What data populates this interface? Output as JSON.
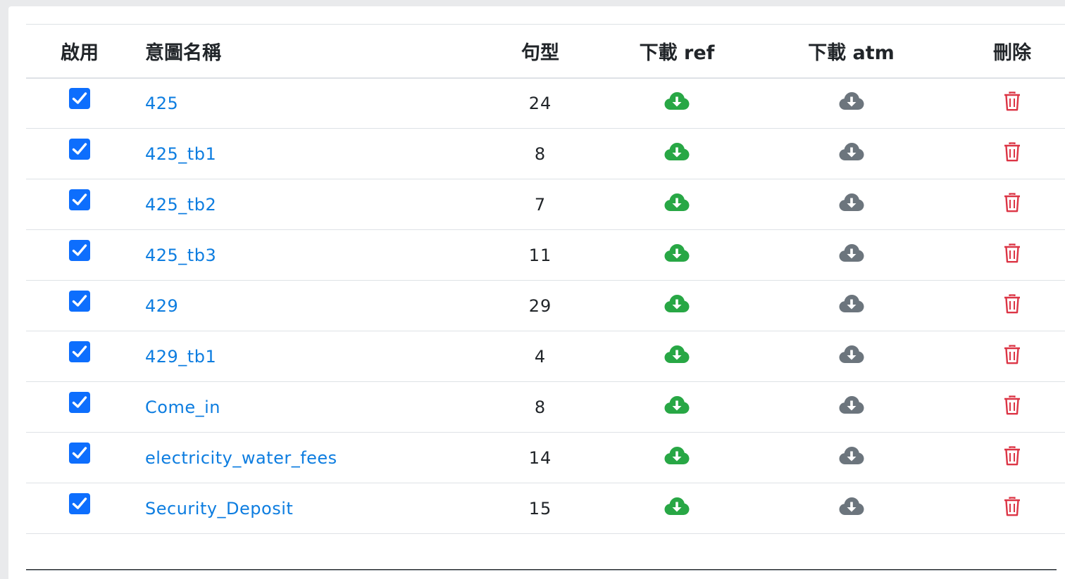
{
  "header": {
    "enabled": "啟用",
    "intent_name": "意圖名稱",
    "sentence_count": "句型",
    "download_ref": "下載 ref",
    "download_atm": "下載 atm",
    "delete": "刪除"
  },
  "rows": [
    {
      "enabled": true,
      "name": "425",
      "count": "24"
    },
    {
      "enabled": true,
      "name": "425_tb1",
      "count": "8"
    },
    {
      "enabled": true,
      "name": "425_tb2",
      "count": "7"
    },
    {
      "enabled": true,
      "name": "425_tb3",
      "count": "11"
    },
    {
      "enabled": true,
      "name": "429",
      "count": "29"
    },
    {
      "enabled": true,
      "name": "429_tb1",
      "count": "4"
    },
    {
      "enabled": true,
      "name": "Come_in",
      "count": "8"
    },
    {
      "enabled": true,
      "name": "electricity_water_fees",
      "count": "14"
    },
    {
      "enabled": true,
      "name": "Security_Deposit",
      "count": "15"
    }
  ],
  "icons": {
    "ref_download": "cloud-download-icon",
    "atm_download": "cloud-download-icon",
    "delete": "trash-icon"
  },
  "colors": {
    "checkbox": "#0d6efd",
    "link": "#0d7de0",
    "ref_icon": "#28a745",
    "atm_icon": "#6c757d",
    "delete_icon": "#dc3545"
  }
}
